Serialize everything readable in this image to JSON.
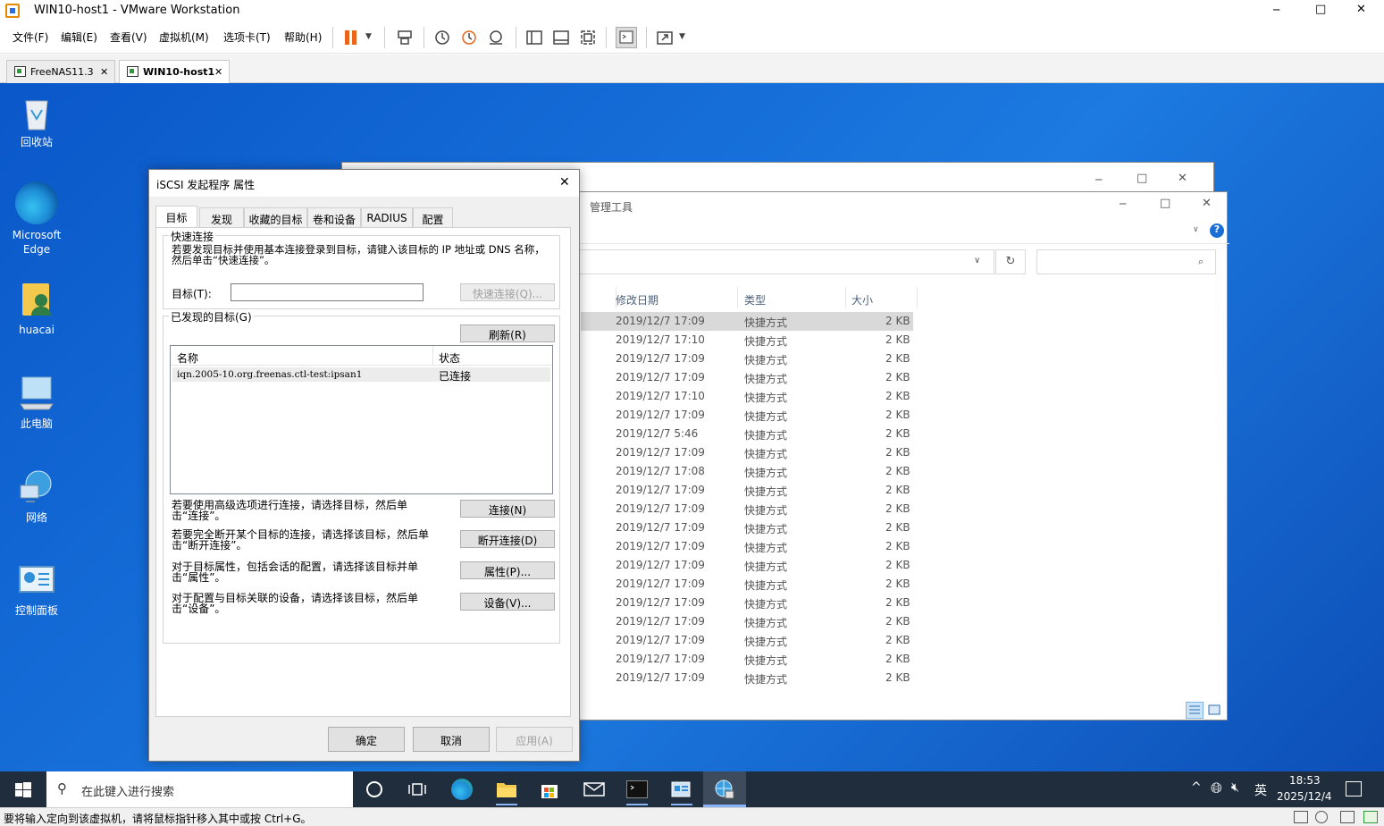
{
  "window": {
    "title": "WIN10-host1 - VMware Workstation",
    "minimize": "─",
    "maximize": "□",
    "close": "✕"
  },
  "menu": [
    "文件(F)",
    "编辑(E)",
    "查看(V)",
    "虚拟机(M)",
    "选项卡(T)",
    "帮助(H)"
  ],
  "toolbar": {
    "icons": [
      "pause-icon",
      "send-keys-icon",
      "snapshot-icon",
      "revert-snapshot-icon",
      "snapshot-manager-icon",
      "library-icon",
      "thumbnail-icon",
      "fullscreen-icon",
      "console-icon",
      "unity-icon"
    ]
  },
  "vm_tabs": [
    {
      "label": "FreeNAS11.3",
      "close": "✕"
    },
    {
      "label": "WIN10-host1",
      "close": "✕"
    }
  ],
  "desktop_icons": [
    {
      "label": "回收站",
      "icon": "recycle-bin-icon"
    },
    {
      "label": "Microsoft Edge",
      "icon": "edge-icon"
    },
    {
      "label": "huacai",
      "icon": "user-folder-icon"
    },
    {
      "label": "此电脑",
      "icon": "this-pc-icon"
    },
    {
      "label": "网络",
      "icon": "network-icon"
    },
    {
      "label": "控制面板",
      "icon": "control-panel-icon"
    }
  ],
  "explorer": {
    "title": "管理工具",
    "columns": {
      "date": "修改日期",
      "type": "类型",
      "size": "大小"
    },
    "rows": [
      {
        "date": "2019/12/7 17:09",
        "type": "快捷方式",
        "size": "2 KB"
      },
      {
        "date": "2019/12/7 17:10",
        "type": "快捷方式",
        "size": "2 KB"
      },
      {
        "date": "2019/12/7 17:09",
        "type": "快捷方式",
        "size": "2 KB"
      },
      {
        "date": "2019/12/7 17:09",
        "type": "快捷方式",
        "size": "2 KB"
      },
      {
        "date": "2019/12/7 17:10",
        "type": "快捷方式",
        "size": "2 KB"
      },
      {
        "date": "2019/12/7 17:09",
        "type": "快捷方式",
        "size": "2 KB"
      },
      {
        "date": "2019/12/7 5:46",
        "type": "快捷方式",
        "size": "2 KB"
      },
      {
        "date": "2019/12/7 17:09",
        "type": "快捷方式",
        "size": "2 KB"
      },
      {
        "date": "2019/12/7 17:08",
        "type": "快捷方式",
        "size": "2 KB"
      },
      {
        "date": "2019/12/7 17:09",
        "type": "快捷方式",
        "size": "2 KB"
      },
      {
        "date": "2019/12/7 17:09",
        "type": "快捷方式",
        "size": "2 KB"
      },
      {
        "date": "2019/12/7 17:09",
        "type": "快捷方式",
        "size": "2 KB"
      },
      {
        "date": "2019/12/7 17:09",
        "type": "快捷方式",
        "size": "2 KB"
      },
      {
        "date": "2019/12/7 17:09",
        "type": "快捷方式",
        "size": "2 KB"
      },
      {
        "date": "2019/12/7 17:09",
        "type": "快捷方式",
        "size": "2 KB"
      },
      {
        "date": "2019/12/7 17:09",
        "type": "快捷方式",
        "size": "2 KB"
      },
      {
        "date": "2019/12/7 17:09",
        "type": "快捷方式",
        "size": "2 KB"
      },
      {
        "date": "2019/12/7 17:09",
        "type": "快捷方式",
        "size": "2 KB"
      },
      {
        "date": "2019/12/7 17:09",
        "type": "快捷方式",
        "size": "2 KB"
      },
      {
        "date": "2019/12/7 17:09",
        "type": "快捷方式",
        "size": "2 KB"
      }
    ]
  },
  "dialog": {
    "title": "iSCSI 发起程序 属性",
    "close": "✕",
    "tabs": [
      "目标",
      "发现",
      "收藏的目标",
      "卷和设备",
      "RADIUS",
      "配置"
    ],
    "quick_connect": {
      "group": "快速连接",
      "desc": "若要发现目标并使用基本连接登录到目标，请键入该目标的 IP 地址或 DNS 名称，然后单击“快速连接”。",
      "target_label": "目标(T):",
      "target_value": "",
      "button": "快速连接(Q)..."
    },
    "discovered": {
      "group": "已发现的目标(G)",
      "refresh": "刷新(R)",
      "col_name": "名称",
      "col_status": "状态",
      "rows": [
        {
          "name": "iqn.2005-10.org.freenas.ctl-test:ipsan1",
          "status": "已连接"
        }
      ]
    },
    "actions": [
      {
        "desc": "若要使用高级选项进行连接，请选择目标，然后单击“连接”。",
        "button": "连接(N)"
      },
      {
        "desc": "若要完全断开某个目标的连接，请选择该目标，然后单击“断开连接”。",
        "button": "断开连接(D)"
      },
      {
        "desc": "对于目标属性，包括会话的配置，请选择该目标并单击“属性”。",
        "button": "属性(P)..."
      },
      {
        "desc": "对于配置与目标关联的设备，请选择该目标，然后单击“设备”。",
        "button": "设备(V)..."
      }
    ],
    "ok": "确定",
    "cancel": "取消",
    "apply": "应用(A)"
  },
  "taskbar": {
    "search_placeholder": "在此键入进行搜索",
    "ime": "英",
    "time": "18:53",
    "date": "2025/12/4"
  },
  "statusbar": {
    "text": "要将输入定向到该虚拟机，请将鼠标指针移入其中或按 Ctrl+G。"
  }
}
